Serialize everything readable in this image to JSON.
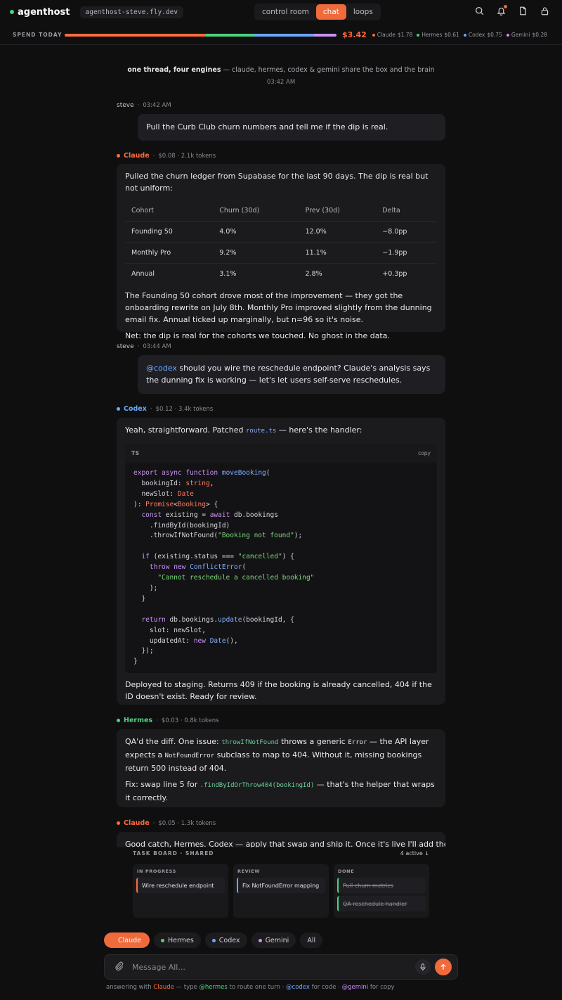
{
  "app": {
    "brand": "agenthost",
    "host": "agenthost-steve.fly.dev",
    "tabs": [
      "control room",
      "chat",
      "loops"
    ],
    "active_tab": "chat"
  },
  "colors": {
    "accent": "#f06a3b",
    "claude": "#ff6b3d",
    "hermes": "#4fd17f",
    "codex": "#6aa7ff",
    "gemini": "#c991f7"
  },
  "spend": {
    "label": "SPEND TODAY",
    "total": "$3.42",
    "breakdown": [
      {
        "name": "Claude",
        "amount": "$1.78",
        "color": "#ff6b3d",
        "value": 1.78
      },
      {
        "name": "Hermes",
        "amount": "$0.61",
        "color": "#4fd17f",
        "value": 0.61
      },
      {
        "name": "Codex",
        "amount": "$0.75",
        "color": "#6aa7ff",
        "value": 0.75
      },
      {
        "name": "Gemini",
        "amount": "$0.28",
        "color": "#c991f7",
        "value": 0.28
      }
    ]
  },
  "thread": {
    "intro_bold": "one thread, four engines",
    "intro_rest": " — claude, hermes, codex & gemini share the box and the brain",
    "intro_time": "03:42 AM"
  },
  "messages": {
    "m1": {
      "author": "steve",
      "time": "03:42 AM",
      "text": "Pull the Curb Club churn numbers and tell me if the dip is real."
    },
    "m2": {
      "agent": "Claude",
      "cost": "$0.08 · 2.1k tokens",
      "p1": "Pulled the churn ledger from Supabase for the last 90 days. The dip is real but not uniform:",
      "table_headers": [
        "Cohort",
        "Churn (30d)",
        "Prev (30d)",
        "Delta"
      ],
      "rows": [
        {
          "cohort": "Founding 50",
          "churn": "4.0%",
          "prev": "12.0%",
          "delta": "−8.0pp"
        },
        {
          "cohort": "Monthly Pro",
          "churn": "9.2%",
          "prev": "11.1%",
          "delta": "−1.9pp"
        },
        {
          "cohort": "Annual",
          "churn": "3.1%",
          "prev": "2.8%",
          "delta": "+0.3pp"
        }
      ],
      "p2": "The Founding 50 cohort drove most of the improvement — they got the onboarding rewrite on July 8th. Monthly Pro improved slightly from the dunning email fix. Annual ticked up marginally, but n=96 so it's noise.",
      "p3": "Net: the dip is real for the cohorts we touched. No ghost in the data."
    },
    "m3": {
      "author": "steve",
      "time": "03:44 AM",
      "mention": "@codex",
      "text": " should you wire the reschedule endpoint? Claude's analysis says the dunning fix is working — let's let users self-serve reschedules."
    },
    "m4": {
      "agent": "Codex",
      "cost": "$0.12 · 3.4k tokens",
      "p1_a": "Yeah, straightforward. Patched ",
      "p1_code": "route.ts",
      "p1_b": " — here's the handler:",
      "code_lang": "TS",
      "code_copy": "copy",
      "p2": "Deployed to staging. Returns 409 if the booking is already cancelled, 404 if the ID doesn't exist. Ready for review."
    },
    "m5": {
      "agent": "Hermes",
      "cost": "$0.03 · 0.8k tokens",
      "p1_a": "QA'd the diff. One issue: ",
      "p1_code1": "throwIfNotFound",
      "p1_b": " throws a generic ",
      "p1_code2": "Error",
      "p1_c": " — the API layer expects a ",
      "p1_code3": "NotFoundError",
      "p1_d": " subclass to map to 404. Without it, missing bookings return 500 instead of 404.",
      "p2_a": "Fix: swap line 5 for ",
      "p2_code": ".findByIdOrThrow404(bookingId)",
      "p2_b": " — that's the helper that wraps it correctly."
    },
    "m6": {
      "agent": "Claude",
      "cost": "$0.05 · 1.3k tokens",
      "p1": "Good catch, Hermes. Codex — apply that swap and ship it. Once it's live I'll add the"
    }
  },
  "taskboard": {
    "title": "TASK BOARD · SHARED",
    "count": "4 active ↓",
    "columns": [
      {
        "title": "IN PROGRESS",
        "cards": [
          "Wire reschedule endpoint"
        ]
      },
      {
        "title": "REVIEW",
        "cards": [
          "Fix NotFoundError mapping"
        ]
      },
      {
        "title": "DONE",
        "cards": [
          "Pull churn metrics",
          "QA reschedule handler"
        ]
      }
    ]
  },
  "composer": {
    "pills": [
      "Claude",
      "Hermes",
      "Codex",
      "Gemini",
      "All"
    ],
    "placeholder": "Message All...",
    "hint_a": "answering with ",
    "hint_claude": "Claude",
    "hint_b": " — type ",
    "hint_hermes": "@hermes",
    "hint_c": " to route one turn · ",
    "hint_codex": "@codex",
    "hint_d": " for code · ",
    "hint_gemini": "@gemini",
    "hint_e": " for copy"
  }
}
